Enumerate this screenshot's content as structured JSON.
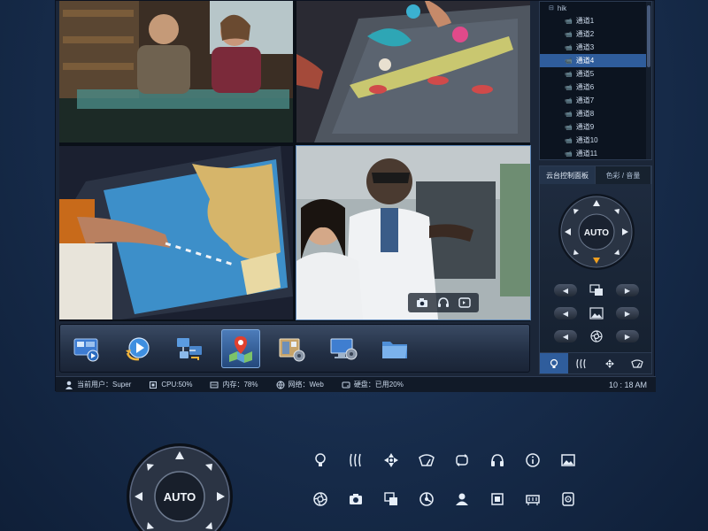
{
  "channel_tree": {
    "root_label": "hik",
    "channels": [
      "通道1",
      "通道2",
      "通道3",
      "通道4",
      "通道5",
      "通道6",
      "通道7",
      "通道8",
      "通道9",
      "通道10",
      "通道11"
    ],
    "selected_channel": "通道4"
  },
  "ptz_panel": {
    "tabs": [
      "云台控制面板",
      "色彩 / 音量"
    ],
    "active_tab": "云台控制面板",
    "wheel_center_label": "AUTO",
    "rows": [
      {
        "icon": "zoom-icon"
      },
      {
        "icon": "image-icon"
      },
      {
        "icon": "aperture-icon"
      }
    ],
    "footer_icons": [
      "light-icon",
      "wiper-heat-icon",
      "fan-icon",
      "wiper-icon"
    ]
  },
  "toolbar": {
    "buttons": [
      {
        "name": "preview-monitor-icon"
      },
      {
        "name": "playback-icon"
      },
      {
        "name": "network-config-icon"
      },
      {
        "name": "map-icon"
      },
      {
        "name": "device-settings-icon"
      },
      {
        "name": "system-settings-icon"
      },
      {
        "name": "folder-icon"
      }
    ],
    "selected": "map-icon"
  },
  "statusbar": {
    "user": "当前用户：Super",
    "cpu": "CPU:50%",
    "memory": "内存：78%",
    "network": "网络：Web",
    "disk": "硬盘：已用20%",
    "time": "10 : 18 AM"
  },
  "big_wheel": {
    "label": "AUTO"
  },
  "colors": {
    "background": "#172c4b",
    "accent": "#2f5d9c",
    "selected_tool": "#4d7dbb",
    "orange_arrow": "#f0a020"
  }
}
